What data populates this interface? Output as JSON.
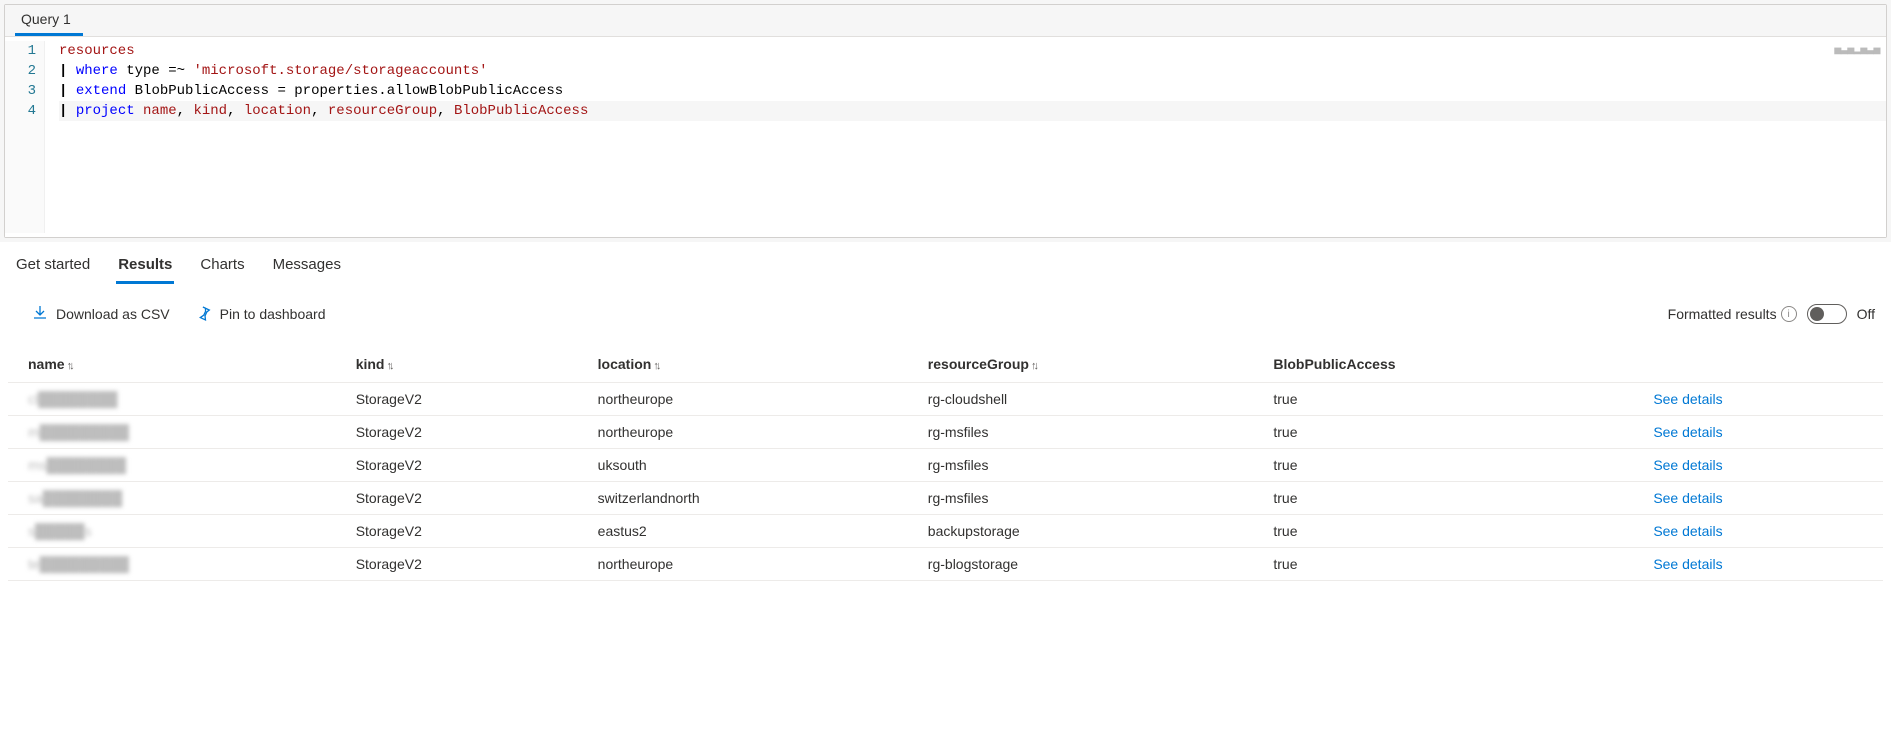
{
  "queryTabs": {
    "active": "Query 1"
  },
  "editor": {
    "lines": [
      {
        "num": "1",
        "tokens": [
          {
            "cls": "tok-ident",
            "t": "resources"
          }
        ]
      },
      {
        "num": "2",
        "tokens": [
          {
            "cls": "tok-pipe",
            "t": "| "
          },
          {
            "cls": "tok-kw",
            "t": "where"
          },
          {
            "cls": "tok-plain",
            "t": " type "
          },
          {
            "cls": "tok-op",
            "t": "=~"
          },
          {
            "cls": "tok-plain",
            "t": " "
          },
          {
            "cls": "tok-str",
            "t": "'microsoft.storage/storageaccounts'"
          }
        ]
      },
      {
        "num": "3",
        "tokens": [
          {
            "cls": "tok-pipe",
            "t": "| "
          },
          {
            "cls": "tok-kw",
            "t": "extend"
          },
          {
            "cls": "tok-plain",
            "t": " BlobPublicAccess "
          },
          {
            "cls": "tok-op",
            "t": "="
          },
          {
            "cls": "tok-plain",
            "t": " properties"
          },
          {
            "cls": "tok-op",
            "t": "."
          },
          {
            "cls": "tok-plain",
            "t": "allowBlobPublicAccess"
          }
        ]
      },
      {
        "num": "4",
        "highlight": true,
        "tokens": [
          {
            "cls": "tok-pipe",
            "t": "| "
          },
          {
            "cls": "tok-kw",
            "t": "project"
          },
          {
            "cls": "tok-plain",
            "t": " "
          },
          {
            "cls": "tok-field",
            "t": "name"
          },
          {
            "cls": "tok-comma",
            "t": ", "
          },
          {
            "cls": "tok-field",
            "t": "kind"
          },
          {
            "cls": "tok-comma",
            "t": ", "
          },
          {
            "cls": "tok-field",
            "t": "location"
          },
          {
            "cls": "tok-comma",
            "t": ", "
          },
          {
            "cls": "tok-field",
            "t": "resourceGroup"
          },
          {
            "cls": "tok-comma",
            "t": ", "
          },
          {
            "cls": "tok-field",
            "t": "BlobPublicAccess"
          }
        ]
      }
    ]
  },
  "resultTabs": {
    "items": [
      "Get started",
      "Results",
      "Charts",
      "Messages"
    ],
    "active": "Results"
  },
  "toolbar": {
    "download_csv": "Download as CSV",
    "pin": "Pin to dashboard",
    "formatted_label": "Formatted results",
    "toggle_state": "Off"
  },
  "table": {
    "columns": [
      {
        "key": "name",
        "label": "name",
        "sortable": true
      },
      {
        "key": "kind",
        "label": "kind",
        "sortable": true
      },
      {
        "key": "location",
        "label": "location",
        "sortable": true
      },
      {
        "key": "resourceGroup",
        "label": "resourceGroup",
        "sortable": true
      },
      {
        "key": "blobPublicAccess",
        "label": "BlobPublicAccess",
        "sortable": false
      }
    ],
    "details_label": "See details",
    "rows": [
      {
        "name": "cl████████",
        "kind": "StorageV2",
        "location": "northeurope",
        "resourceGroup": "rg-cloudshell",
        "blobPublicAccess": "true"
      },
      {
        "name": "m█████████",
        "kind": "StorageV2",
        "location": "northeurope",
        "resourceGroup": "rg-msfiles",
        "blobPublicAccess": "true"
      },
      {
        "name": "ms████████",
        "kind": "StorageV2",
        "location": "uksouth",
        "resourceGroup": "rg-msfiles",
        "blobPublicAccess": "true"
      },
      {
        "name": "sa████████",
        "kind": "StorageV2",
        "location": "switzerlandnorth",
        "resourceGroup": "rg-msfiles",
        "blobPublicAccess": "true"
      },
      {
        "name": "s█████s",
        "kind": "StorageV2",
        "location": "eastus2",
        "resourceGroup": "backupstorage",
        "blobPublicAccess": "true"
      },
      {
        "name": "te█████████",
        "kind": "StorageV2",
        "location": "northeurope",
        "resourceGroup": "rg-blogstorage",
        "blobPublicAccess": "true"
      }
    ]
  }
}
